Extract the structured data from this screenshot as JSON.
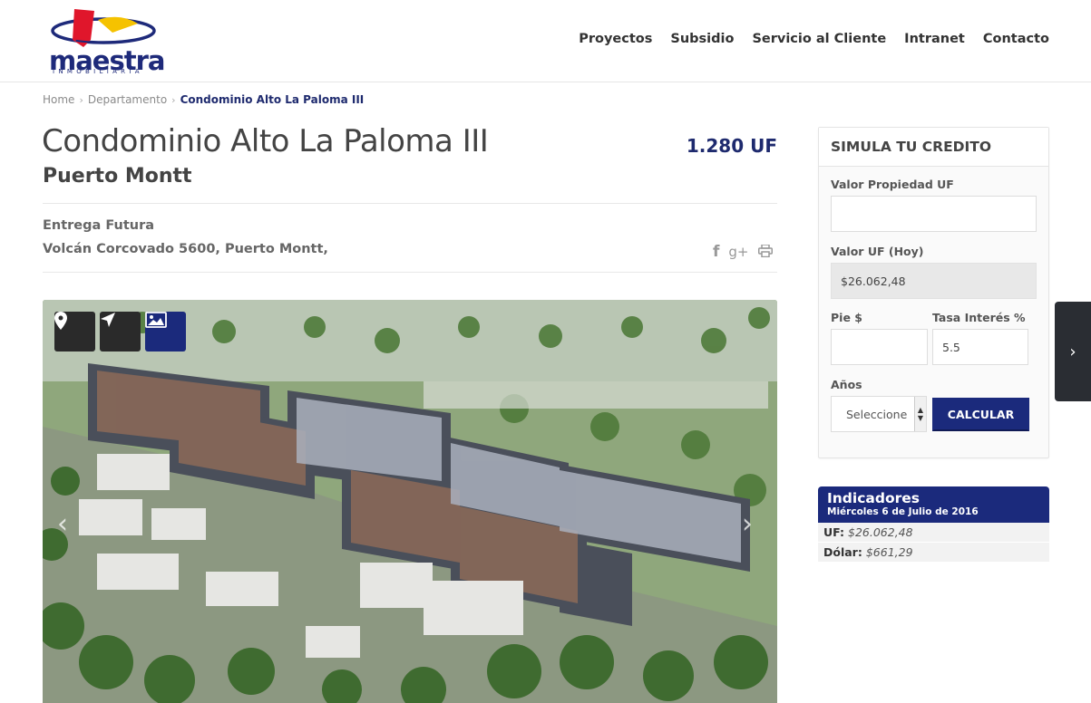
{
  "header": {
    "logo_text": "maestra",
    "logo_sub": "INMOBILIARIA",
    "nav": [
      "Proyectos",
      "Subsidio",
      "Servicio al Cliente",
      "Intranet",
      "Contacto"
    ]
  },
  "breadcrumb": {
    "items": [
      "Home",
      "Departamento"
    ],
    "current": "Condominio Alto La Paloma III",
    "separator": "›"
  },
  "property": {
    "title": "Condominio Alto La Paloma III",
    "city": "Puerto Montt",
    "price": "1.280 UF",
    "delivery": "Entrega Futura",
    "address": "Volcán Corcovado 5600, Puerto Montt,"
  },
  "share": {
    "facebook": "f",
    "google_plus": "g+",
    "print_icon": "print-icon"
  },
  "hero": {
    "buttons": [
      "map-pin-icon",
      "navigation-arrow-icon",
      "image-icon"
    ],
    "prev_arrow": "‹",
    "next_arrow": "›"
  },
  "side_tab": {
    "arrow": "›"
  },
  "simulator": {
    "title": "SIMULA TU CREDITO",
    "valor_propiedad_label": "Valor Propiedad UF",
    "valor_propiedad_value": "",
    "valor_uf_label": "Valor UF (Hoy)",
    "valor_uf_value": "$26.062,48",
    "pie_label": "Pie $",
    "pie_value": "",
    "tasa_label": "Tasa Interés %",
    "tasa_value": "5.5",
    "anos_label": "Años",
    "anos_value": "Seleccione",
    "calc_button": "CALCULAR"
  },
  "indicadores": {
    "title": "Indicadores",
    "date": "Miércoles 6 de Julio de 2016",
    "rows": [
      {
        "label": "UF:",
        "value": "$26.062,48"
      },
      {
        "label": "Dólar:",
        "value": "$661,29"
      }
    ]
  },
  "colors": {
    "brand_blue": "#1b2a7c",
    "logo_red": "#e0162b",
    "logo_yellow": "#f5c200"
  }
}
